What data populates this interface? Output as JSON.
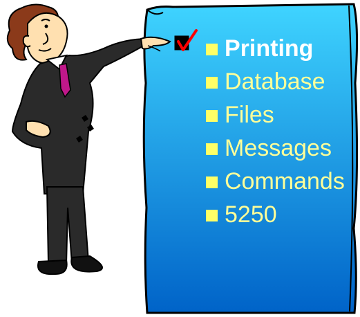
{
  "topics": [
    {
      "label": "Printing",
      "active": true
    },
    {
      "label": "Database",
      "active": false
    },
    {
      "label": "Files",
      "active": false
    },
    {
      "label": "Messages",
      "active": false
    },
    {
      "label": "Commands",
      "active": false
    },
    {
      "label": "5250",
      "active": false
    }
  ],
  "colors": {
    "board_top": "#33ccff",
    "board_bottom": "#0066cc",
    "bullet": "#ffff66",
    "active_text": "#ffffff",
    "item_text": "#ffff99",
    "check": "#ff0000"
  },
  "icons": [
    "presenter-clipart",
    "checkbox-checked-icon"
  ]
}
